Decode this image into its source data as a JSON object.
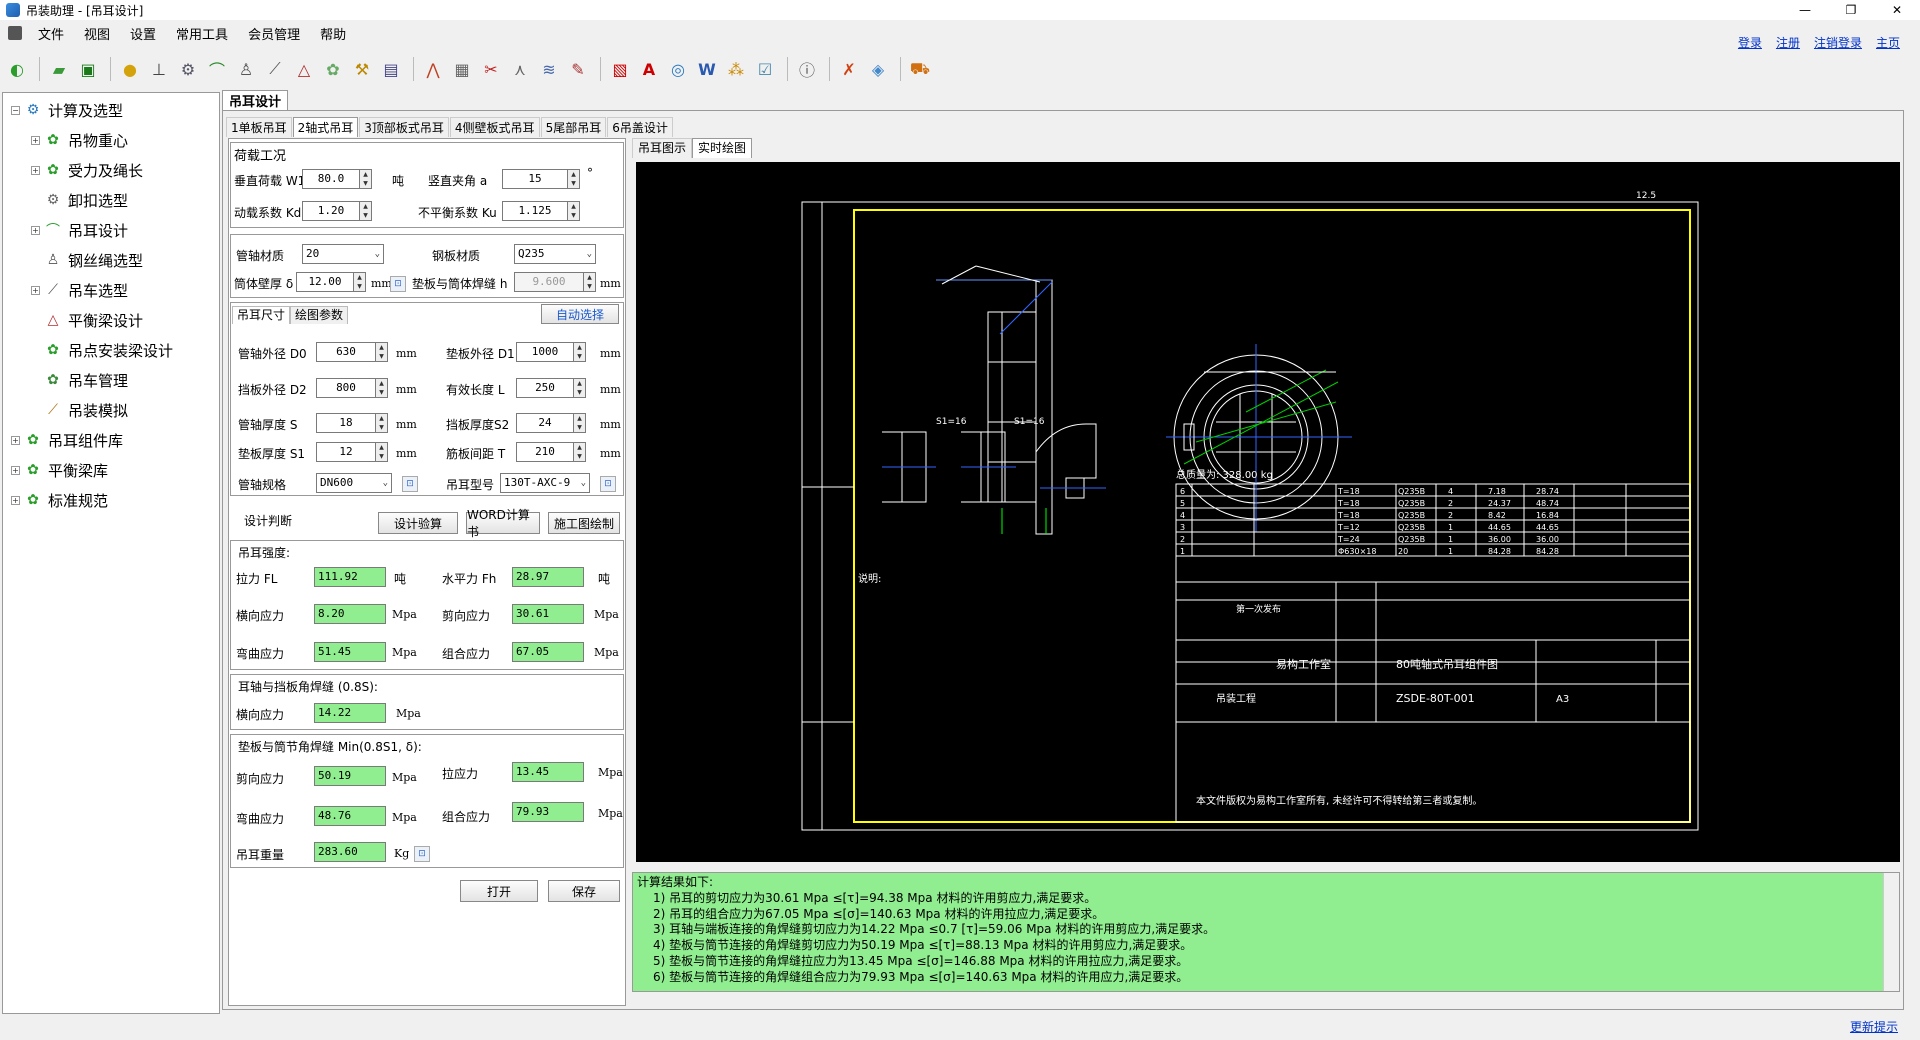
{
  "window": {
    "title": "吊装助理 - [吊耳设计]"
  },
  "menu": [
    "文件",
    "视图",
    "设置",
    "常用工具",
    "会员管理",
    "帮助"
  ],
  "top_links": [
    "登录",
    "注册",
    "注销登录",
    "主页"
  ],
  "tree": [
    {
      "label": "计算及选型",
      "level": 0,
      "exp": "−"
    },
    {
      "label": "吊物重心",
      "level": 1,
      "exp": "+"
    },
    {
      "label": "受力及绳长",
      "level": 1,
      "exp": "+"
    },
    {
      "label": "卸扣选型",
      "level": 1,
      "exp": ""
    },
    {
      "label": "吊耳设计",
      "level": 1,
      "exp": "+"
    },
    {
      "label": "钢丝绳选型",
      "level": 1,
      "exp": ""
    },
    {
      "label": "吊车选型",
      "level": 1,
      "exp": "+"
    },
    {
      "label": "平衡梁设计",
      "level": 1,
      "exp": ""
    },
    {
      "label": "吊点安装梁设计",
      "level": 1,
      "exp": ""
    },
    {
      "label": "吊车管理",
      "level": 1,
      "exp": ""
    },
    {
      "label": "吊装模拟",
      "level": 1,
      "exp": ""
    },
    {
      "label": "吊耳组件库",
      "level": 0,
      "exp": "+"
    },
    {
      "label": "平衡梁库",
      "level": 0,
      "exp": "+"
    },
    {
      "label": "标准规范",
      "level": 0,
      "exp": "+"
    }
  ],
  "main_tab": "吊耳设计",
  "subtabs": [
    "1单板吊耳",
    "2轴式吊耳",
    "3顶部板式吊耳",
    "4侧壁板式吊耳",
    "5尾部吊耳",
    "6吊盖设计"
  ],
  "load": {
    "section": "荷载工况",
    "w1_label": "垂直荷载 W1",
    "w1": "80.0",
    "w1_unit": "吨",
    "angle_label": "竖直夹角 a",
    "angle": "15",
    "angle_unit": "°",
    "kd_label": "动载系数 Kd",
    "kd": "1.20",
    "ku_label": "不平衡系数 Ku",
    "ku": "1.125"
  },
  "material": {
    "pipe_label": "管轴材质",
    "pipe": "20",
    "plate_label": "钢板材质",
    "plate": "Q235",
    "wall_label": "筒体壁厚 δ",
    "wall": "12.00",
    "wall_unit": "mm",
    "weld_label": "垫板与筒体焊缝 h",
    "weld": "9.600",
    "weld_unit": "mm"
  },
  "size_tabs": [
    "吊耳尺寸",
    "绘图参数"
  ],
  "auto_select": "自动选择",
  "size": {
    "d0_label": "管轴外径 D0",
    "d0": "630",
    "d1_label": "垫板外径 D1",
    "d1": "1000",
    "d2_label": "挡板外径 D2",
    "d2": "800",
    "l_label": "有效长度 L",
    "l": "250",
    "s_label": "管轴厚度 S",
    "s": "18",
    "s2_label": "挡板厚度S2",
    "s2": "24",
    "s1_label": "垫板厚度 S1",
    "s1": "12",
    "t_label": "筋板间距 T",
    "t": "210",
    "spec_label": "管轴规格",
    "spec": "DN600",
    "type_label": "吊耳型号",
    "type": "130T-AXC-9",
    "unit": "mm"
  },
  "design": {
    "label": "设计判断",
    "verify": "设计验算",
    "word": "WORD计算书",
    "draw": "施工图绘制"
  },
  "strength": {
    "title": "吊耳强度:",
    "fl_label": "拉力 FL",
    "fl": "111.92",
    "fl_unit": "吨",
    "fh_label": "水平力 Fh",
    "fh": "28.97",
    "fh_unit": "吨",
    "trans_label": "横向应力",
    "trans": "8.20",
    "shear_label": "剪向应力",
    "shear": "30.61",
    "bend_label": "弯曲应力",
    "bend": "51.45",
    "comb_label": "组合应力",
    "comb": "67.05",
    "unit": "Mpa"
  },
  "weld1": {
    "title": "耳轴与挡板角焊缝 (0.8S):",
    "trans_label": "横向应力",
    "trans": "14.22",
    "unit": "Mpa"
  },
  "weld2": {
    "title": "垫板与筒节角焊缝 Min(0.8S1, δ):",
    "shear_label": "剪向应力",
    "shear": "50.19",
    "tension_label": "拉应力",
    "tension": "13.45",
    "bend_label": "弯曲应力",
    "bend": "48.76",
    "comb_label": "组合应力",
    "comb": "79.93",
    "unit": "Mpa",
    "weight_label": "吊耳重量",
    "weight": "283.60",
    "weight_unit": "Kg"
  },
  "buttons": {
    "open": "打开",
    "save": "保存"
  },
  "right_tabs": [
    "吊耳图示",
    "实时绘图"
  ],
  "drawing": {
    "total_weight": "总质量为: 328.00 kg",
    "studio": "易构工作室",
    "drawing_name": "80吨轴式吊耳组件图",
    "drawing_no": "ZSDE-80T-001",
    "project": "吊装工程",
    "scale": "A3",
    "notice": "本文件版权为易构工作室所有, 未经许可不得转给第三者或复制。",
    "title_bar": "第一次发布",
    "roughness": "12.5",
    "weld_s1a": "S1=16",
    "weld_s1b": "S1=16",
    "rows": [
      [
        "6",
        "Q235B",
        "4",
        "7.18",
        "28.74"
      ],
      [
        "5",
        "Q235B",
        "2",
        "24.37",
        "48.74"
      ],
      [
        "4",
        "Q235B",
        "2",
        "8.42",
        "16.84"
      ],
      [
        "3",
        "Q235B",
        "1",
        "44.65",
        "44.65"
      ],
      [
        "2",
        "Q235B",
        "1",
        "36.00",
        "36.00"
      ],
      [
        "1",
        "20",
        "1",
        "84.28",
        "84.28"
      ]
    ],
    "row_specs": [
      "T=18",
      "T=18",
      "T=18",
      "T=12",
      "T=24",
      "Φ630×18"
    ],
    "notes_title": "说明:"
  },
  "results": {
    "title": "计算结果如下:",
    "lines": [
      "1) 吊耳的剪切应力为30.61 Mpa ≤[τ]=94.38 Mpa 材料的许用剪应力,满足要求。",
      "2) 吊耳的组合应力为67.05 Mpa ≤[σ]=140.63 Mpa 材料的许用拉应力,满足要求。",
      "3) 耳轴与端板连接的角焊缝剪切应力为14.22 Mpa ≤0.7 [τ]=59.06 Mpa 材料的许用剪应力,满足要求。",
      "4) 垫板与筒节连接的角焊缝剪切应力为50.19 Mpa ≤[τ]=88.13 Mpa 材料的许用剪应力,满足要求。",
      "5) 垫板与筒节连接的角焊缝拉应力为13.45 Mpa ≤[σ]=146.88 Mpa 材料的许用拉应力,满足要求。",
      "6) 垫板与筒节连接的角焊缝组合应力为79.93 Mpa ≤[σ]=140.63 Mpa 材料的许用应力,满足要求。"
    ]
  },
  "bottom_link": "更新提示"
}
